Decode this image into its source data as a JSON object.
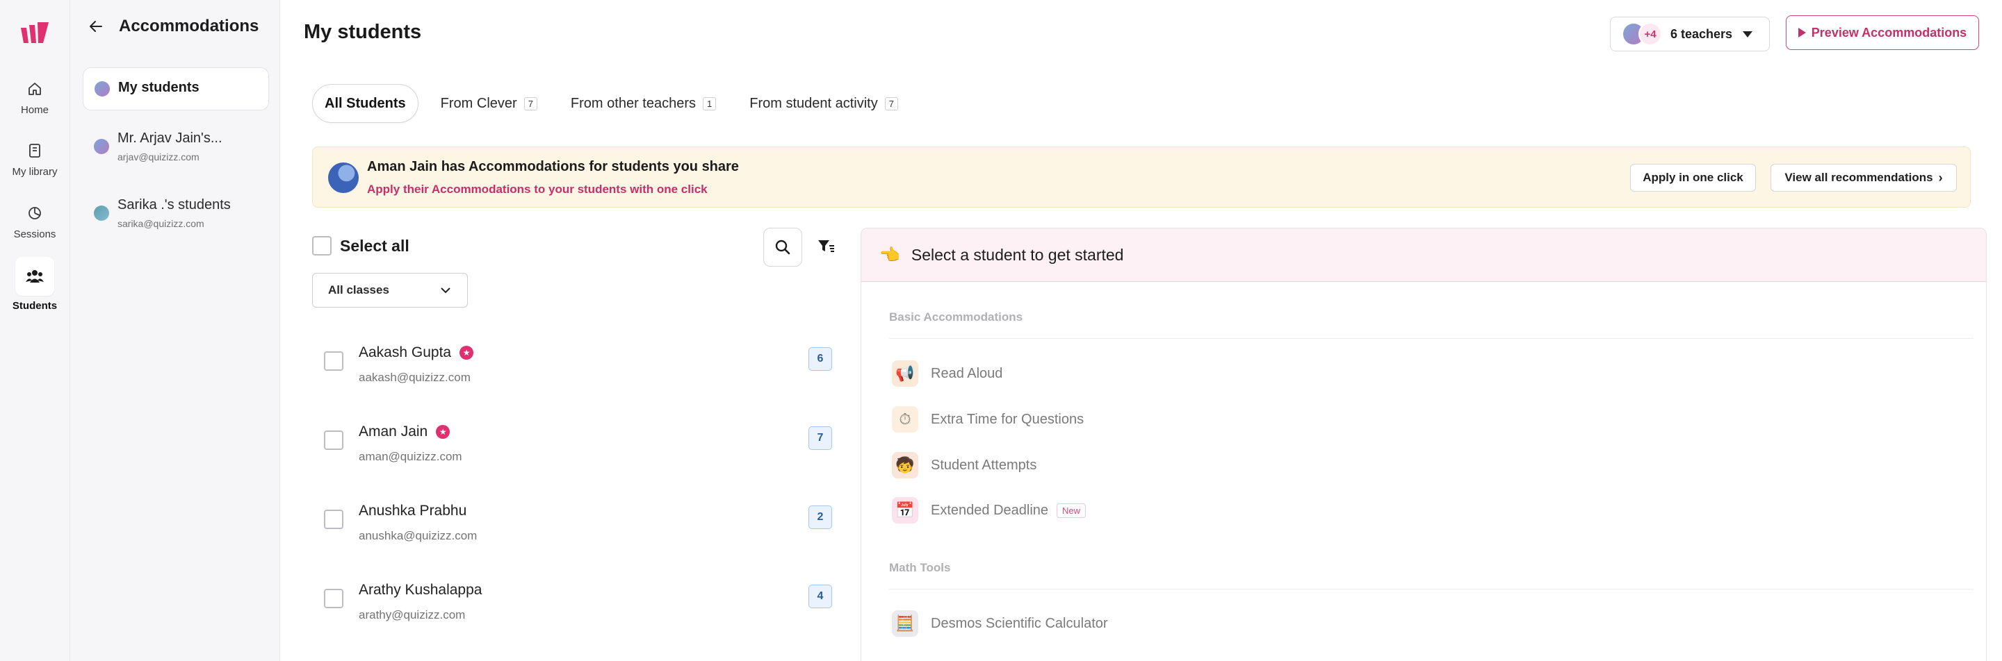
{
  "rail": {
    "items": [
      {
        "label": "Home"
      },
      {
        "label": "My library"
      },
      {
        "label": "Sessions"
      },
      {
        "label": "Students"
      }
    ]
  },
  "sidebar": {
    "title": "Accommodations",
    "items": [
      {
        "name": "My students",
        "email": ""
      },
      {
        "name": "Mr. Arjav Jain's...",
        "email": "arjav@quizizz.com"
      },
      {
        "name": "Sarika .'s students",
        "email": "sarika@quizizz.com"
      }
    ]
  },
  "header": {
    "title": "My students",
    "teachers_extra": "+4",
    "teachers_label": "6 teachers",
    "preview_label": "Preview Accommodations"
  },
  "tabs": [
    {
      "label": "All Students",
      "count": ""
    },
    {
      "label": "From Clever",
      "count": "7"
    },
    {
      "label": "From other teachers",
      "count": "1"
    },
    {
      "label": "From student activity",
      "count": "7"
    }
  ],
  "banner": {
    "title": "Aman Jain has Accommodations for students you share",
    "subtitle": "Apply their Accommodations to your students with one click",
    "apply_label": "Apply in one click",
    "view_label": "View all recommendations"
  },
  "list": {
    "select_all": "Select all",
    "class_filter": "All classes",
    "students": [
      {
        "name": "Aakash Gupta",
        "email": "aakash@quizizz.com",
        "count": "6",
        "starred": true
      },
      {
        "name": "Aman Jain",
        "email": "aman@quizizz.com",
        "count": "7",
        "starred": true
      },
      {
        "name": "Anushka Prabhu",
        "email": "anushka@quizizz.com",
        "count": "2",
        "starred": false
      },
      {
        "name": "Arathy Kushalappa",
        "email": "arathy@quizizz.com",
        "count": "4",
        "starred": false
      }
    ]
  },
  "panel": {
    "prompt": "Select a student to get started",
    "basic_title": "Basic Accommodations",
    "basic_items": [
      {
        "label": "Read Aloud",
        "icon": "megaphone-icon",
        "badge": ""
      },
      {
        "label": "Extra Time for Questions",
        "icon": "clock-icon",
        "badge": ""
      },
      {
        "label": "Student Attempts",
        "icon": "student-icon",
        "badge": ""
      },
      {
        "label": "Extended Deadline",
        "icon": "calendar-icon",
        "badge": "New"
      }
    ],
    "math_title": "Math Tools",
    "math_items": [
      {
        "label": "Desmos Scientific Calculator",
        "icon": "calculator-icon"
      }
    ]
  },
  "colors": {
    "brand": "#c5306a",
    "banner_bg": "#fdf6e4",
    "count_badge": "#eaf3fd"
  }
}
